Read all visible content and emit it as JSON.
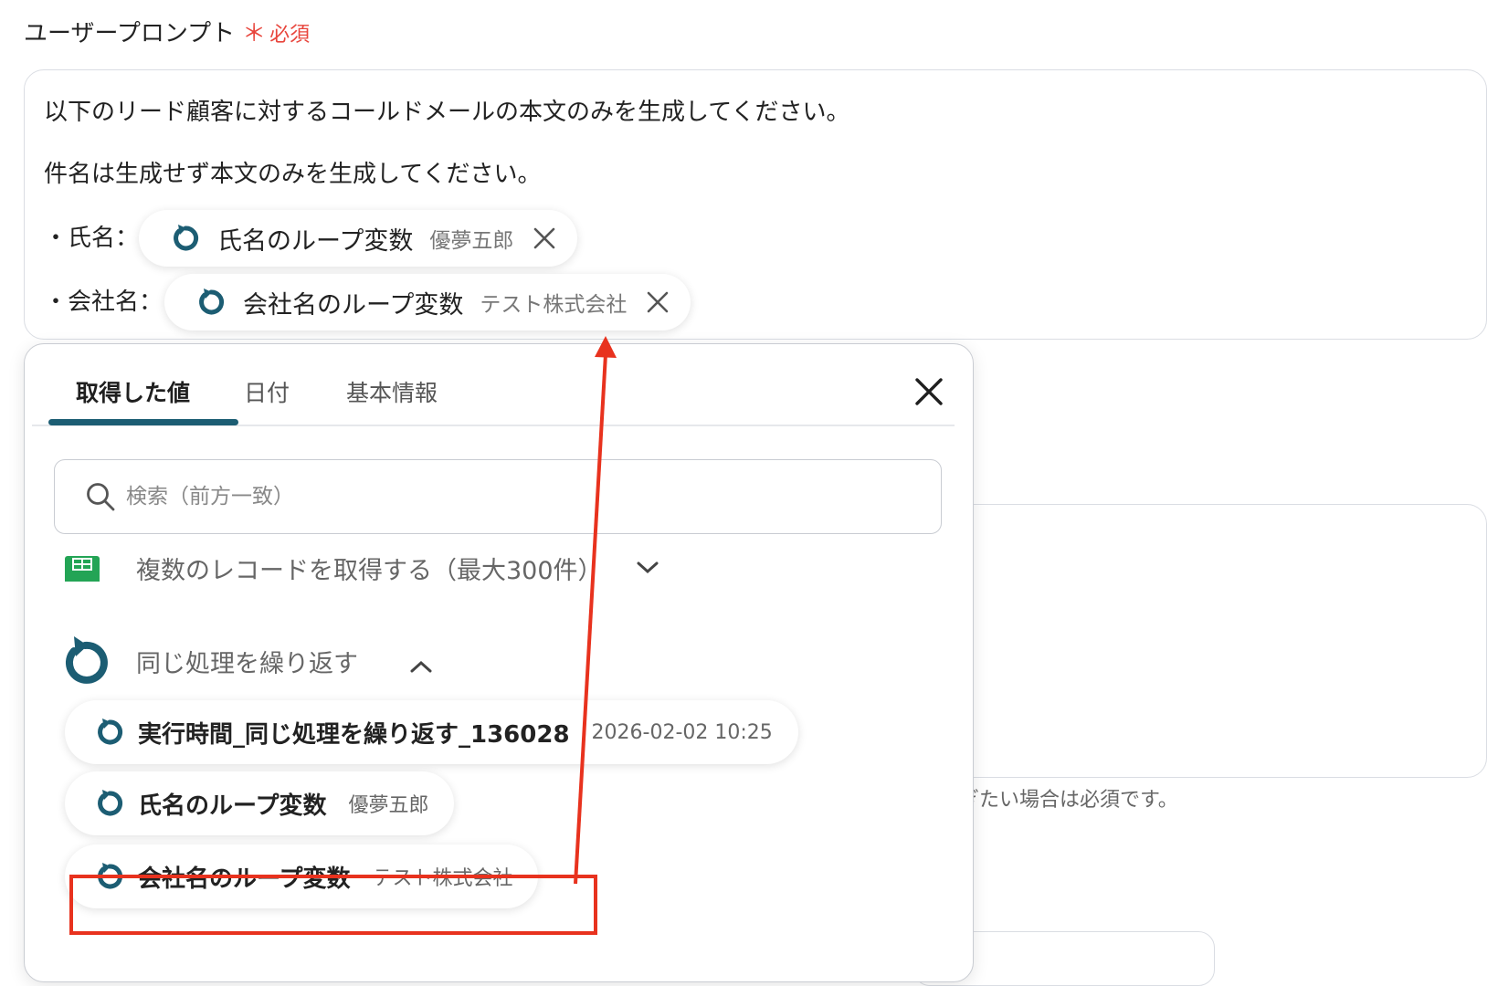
{
  "field": {
    "label": "ユーザープロンプト",
    "required_mark": "＊",
    "required_text": "必須"
  },
  "prompt": {
    "line1": "以下のリード顧客に対するコールドメールの本文のみを生成してください。",
    "line2": "件名は生成せず本文のみを生成してください。",
    "line3_prefix": "・氏名：",
    "line4_prefix": "・会社名：",
    "chips": [
      {
        "name": "氏名のループ変数",
        "value": "優夢五郎"
      },
      {
        "name": "会社名のループ変数",
        "value": "テスト株式会社"
      }
    ]
  },
  "background": {
    "help_text": "ぎたい場合は必須です。"
  },
  "popup": {
    "tabs": [
      "取得した値",
      "日付",
      "基本情報"
    ],
    "active_tab": 0,
    "search_placeholder": "検索（前方一致）",
    "group1_title": "複数のレコードを取得する（最大300件）",
    "group2_title": "同じ処理を繰り返す",
    "items": [
      {
        "name": "実行時間_同じ処理を繰り返す_136028",
        "value": "2026-02-02 10:25"
      },
      {
        "name": "氏名のループ変数",
        "value": "優夢五郎"
      },
      {
        "name": "会社名のループ変数",
        "value": "テスト株式会社"
      }
    ]
  },
  "colors": {
    "accent": "#1c5d73",
    "required": "#e8453c",
    "highlight": "#e8321e",
    "sheet_icon": "#23a455"
  },
  "icons": {
    "loop": "loop-arrow-icon",
    "remove": "close-icon",
    "search": "search-icon",
    "sheet": "spreadsheet-icon"
  }
}
